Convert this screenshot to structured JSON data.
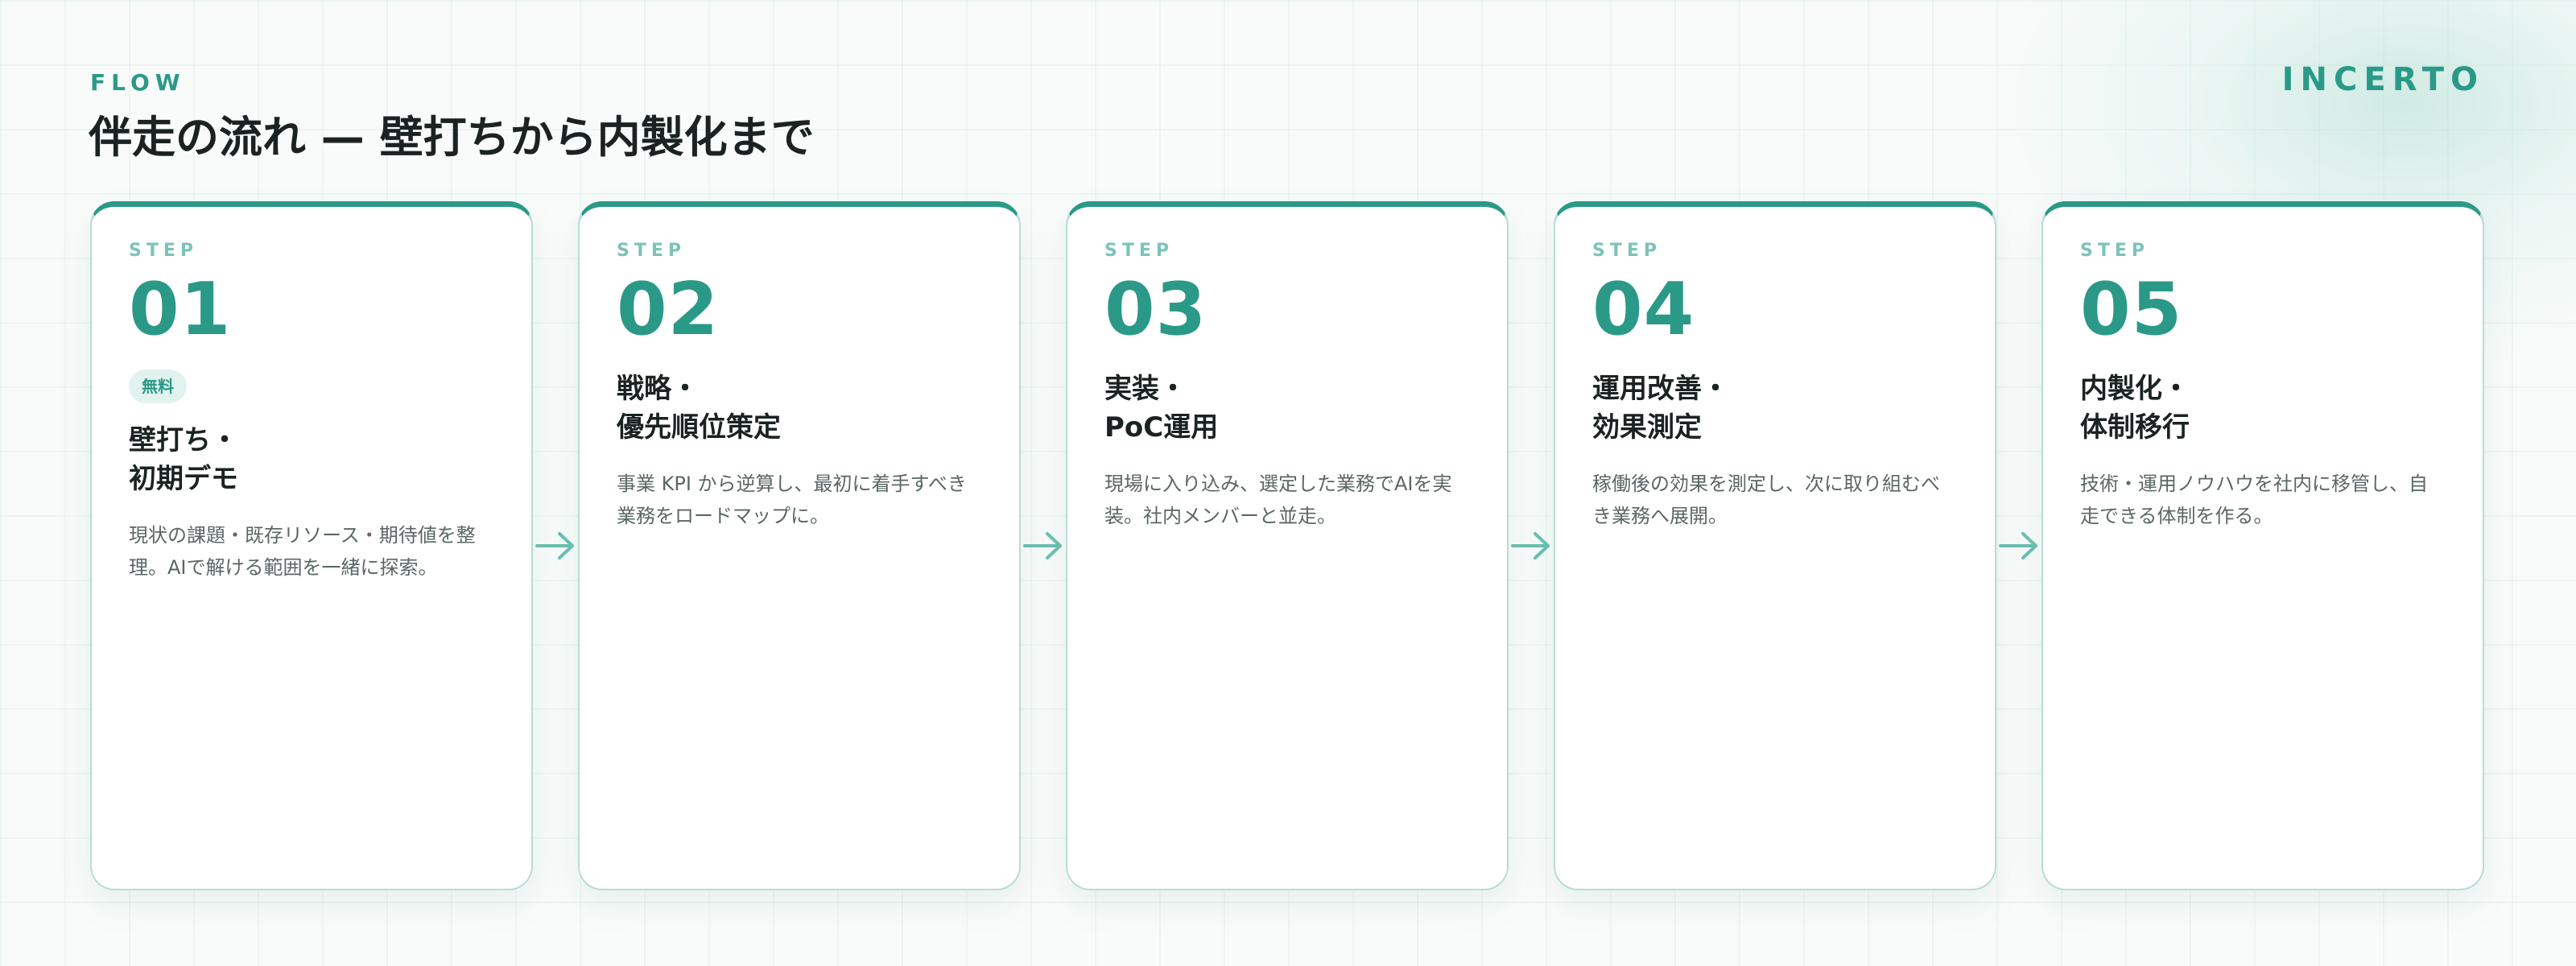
{
  "header": {
    "eyebrow": "FLOW",
    "title": "伴走の流れ — 壁打ちから内製化まで",
    "brand": "INCERTO"
  },
  "accent_color": "#2b9987",
  "steps": [
    {
      "label": "STEP",
      "number": "01",
      "badge": "無料",
      "title_lines": [
        "壁打ち・",
        "初期デモ"
      ],
      "description": "現状の課題・既存リソース・期待値を整理。AIで解ける範囲を一緒に探索。"
    },
    {
      "label": "STEP",
      "number": "02",
      "title_lines": [
        "戦略・",
        "優先順位策定"
      ],
      "description": "事業 KPI から逆算し、最初に着手すべき業務をロードマップに。"
    },
    {
      "label": "STEP",
      "number": "03",
      "title_lines": [
        "実装・",
        "PoC運用"
      ],
      "description": "現場に入り込み、選定した業務でAIを実装。社内メンバーと並走。"
    },
    {
      "label": "STEP",
      "number": "04",
      "title_lines": [
        "運用改善・",
        "効果測定"
      ],
      "description": "稼働後の効果を測定し、次に取り組むべき業務へ展開。"
    },
    {
      "label": "STEP",
      "number": "05",
      "title_lines": [
        "内製化・",
        "体制移行"
      ],
      "description": "技術・運用ノウハウを社内に移管し、自走できる体制を作る。"
    }
  ],
  "icons": {
    "step_arrow": "arrow-right-icon"
  }
}
